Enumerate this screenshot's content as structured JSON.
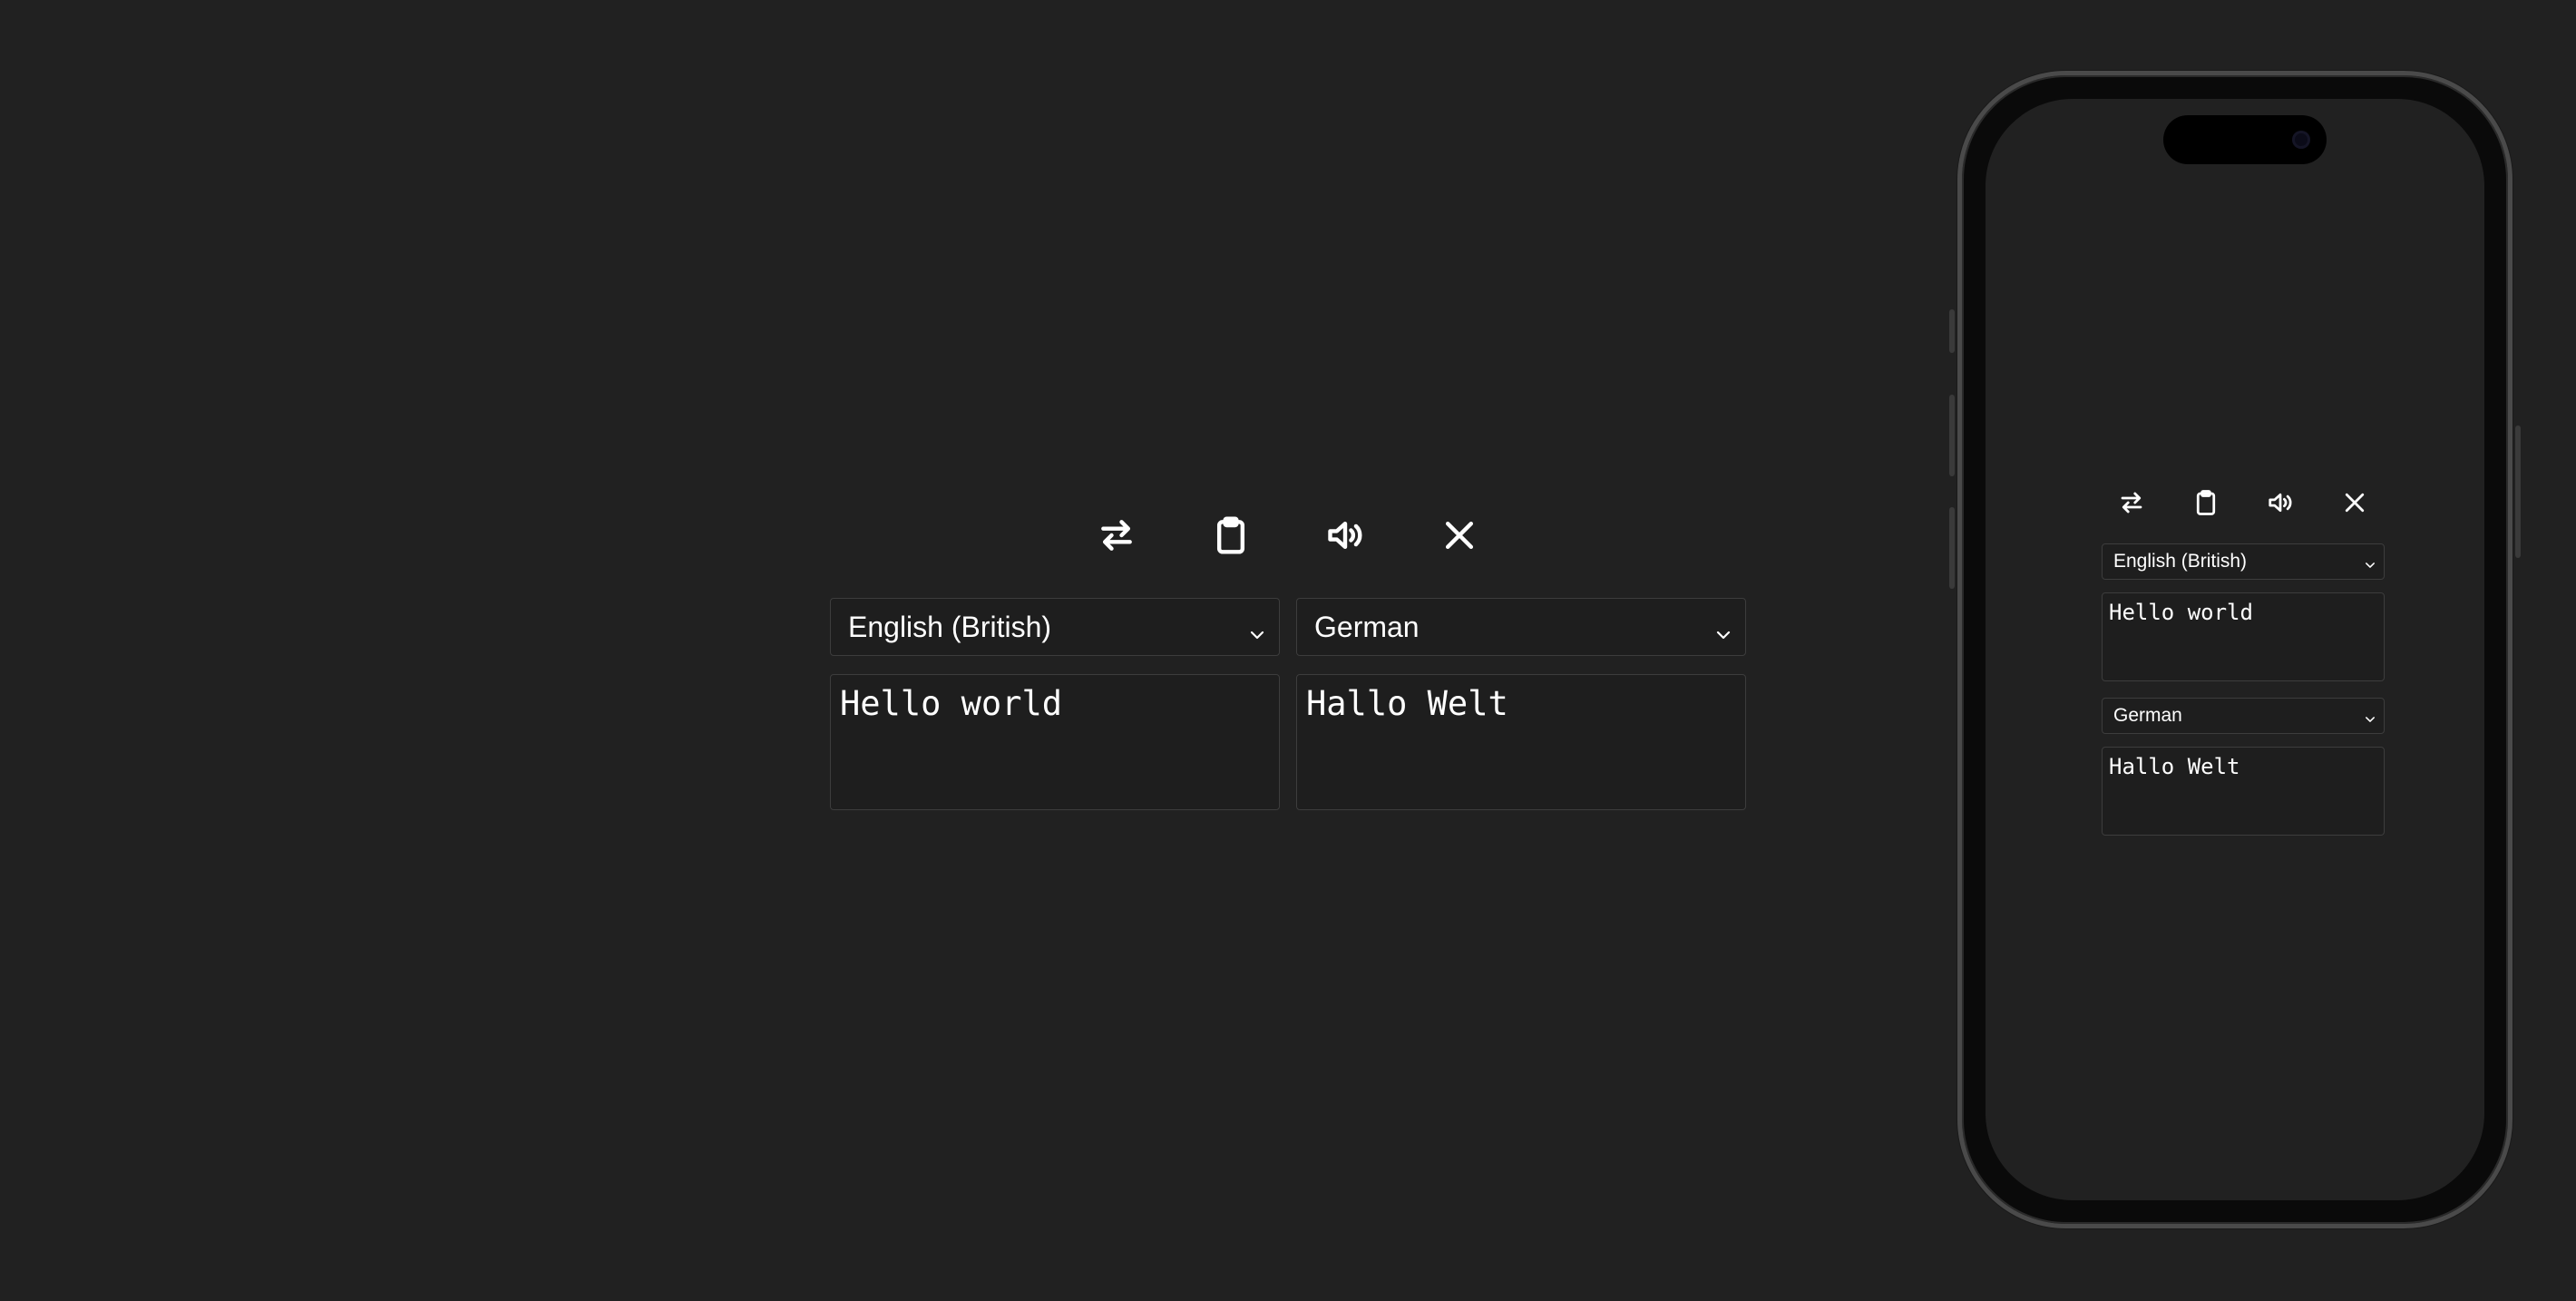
{
  "app": {
    "toolbar": {
      "swap_icon": "swap-arrows-icon",
      "clipboard_icon": "clipboard-icon",
      "speaker_icon": "speaker-icon",
      "close_icon": "close-icon"
    },
    "source": {
      "language": "English (British)",
      "text": "Hello world"
    },
    "target": {
      "language": "German",
      "text": "Hallo Welt"
    }
  },
  "colors": {
    "background": "#212121",
    "border": "#3d3d3d",
    "text": "#ffffff",
    "phone_frame": "#4a4a4a"
  }
}
